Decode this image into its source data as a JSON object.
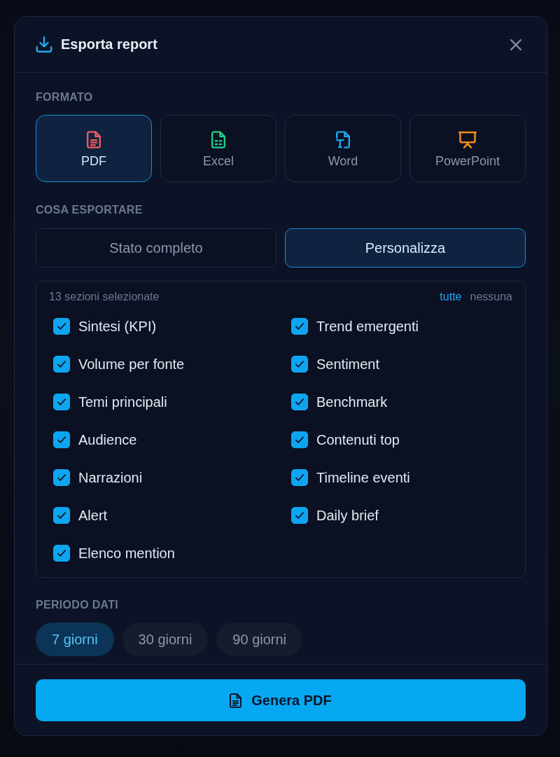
{
  "dialog": {
    "title": "Esporta report"
  },
  "format": {
    "label": "FORMATO",
    "options": [
      {
        "label": "PDF",
        "kind": "pdf",
        "color": "#f25a5f",
        "selected": true
      },
      {
        "label": "Excel",
        "kind": "excel",
        "color": "#1fcf86",
        "selected": false
      },
      {
        "label": "Word",
        "kind": "word",
        "color": "#1ea9f0",
        "selected": false
      },
      {
        "label": "PowerPoint",
        "kind": "powerpoint",
        "color": "#f98c1c",
        "selected": false
      }
    ]
  },
  "scope": {
    "label": "COSA ESPORTARE",
    "options": [
      {
        "label": "Stato completo",
        "selected": false
      },
      {
        "label": "Personalizza",
        "selected": true
      }
    ]
  },
  "sections": {
    "count": "13 sezioni selezionate",
    "actions": [
      {
        "label": "tutte",
        "active": true
      },
      {
        "label": "nessuna",
        "active": false
      }
    ],
    "items": [
      {
        "label": "Sintesi (KPI)",
        "checked": true
      },
      {
        "label": "Trend emergenti",
        "checked": true
      },
      {
        "label": "Volume per fonte",
        "checked": true
      },
      {
        "label": "Sentiment",
        "checked": true
      },
      {
        "label": "Temi principali",
        "checked": true
      },
      {
        "label": "Benchmark",
        "checked": true
      },
      {
        "label": "Audience",
        "checked": true
      },
      {
        "label": "Contenuti top",
        "checked": true
      },
      {
        "label": "Narrazioni",
        "checked": true
      },
      {
        "label": "Timeline eventi",
        "checked": true
      },
      {
        "label": "Alert",
        "checked": true
      },
      {
        "label": "Daily brief",
        "checked": true
      },
      {
        "label": "Elenco mention",
        "checked": true
      }
    ]
  },
  "period": {
    "label": "PERIODO DATI",
    "options": [
      {
        "label": "7 giorni",
        "selected": true
      },
      {
        "label": "30 giorni",
        "selected": false
      },
      {
        "label": "90 giorni",
        "selected": false
      }
    ]
  },
  "submit": {
    "label": "Genera PDF"
  }
}
